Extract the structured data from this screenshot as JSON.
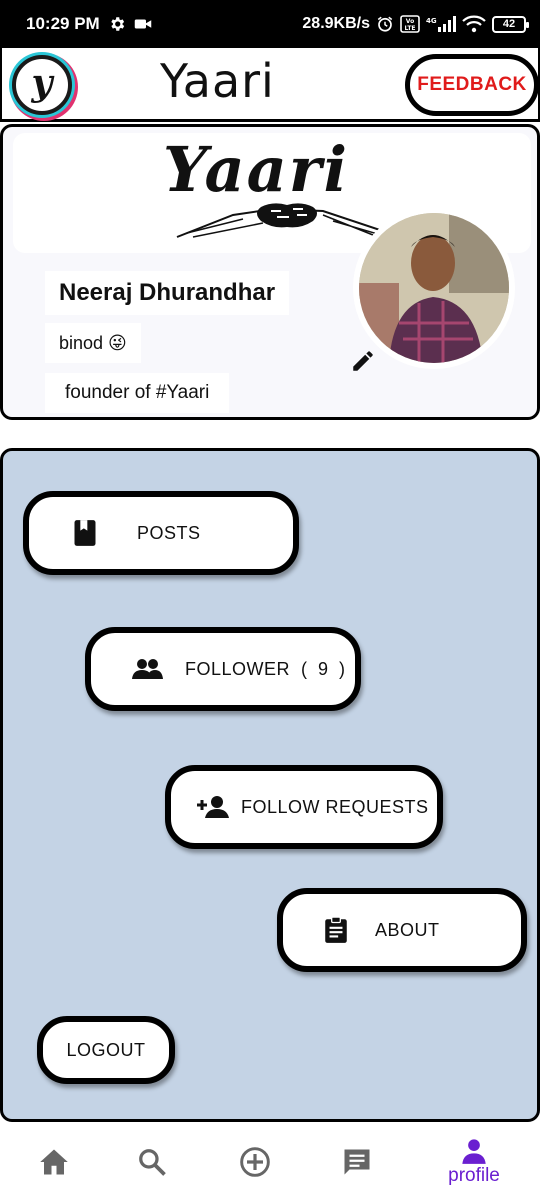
{
  "status_bar": {
    "time": "10:29 PM",
    "net_speed": "28.9KB/s",
    "network": "4G",
    "battery": "42"
  },
  "app_bar": {
    "logo_letter": "y",
    "title": "Yaari",
    "feedback_label": "FEEDBACK"
  },
  "profile": {
    "banner_text": "Yaari",
    "name": "Neeraj Dhurandhar",
    "status": "binod 😜",
    "bio": "founder of #Yaari"
  },
  "menu": {
    "posts_label": "POSTS",
    "follower_label": "FOLLOWER",
    "follower_count": "( 9 )",
    "follow_requests_label": "FOLLOW REQUESTS",
    "about_label": "ABOUT",
    "logout_label": "LOGOUT"
  },
  "bottom_nav": {
    "items": [
      {
        "icon": "home-icon"
      },
      {
        "icon": "search-icon"
      },
      {
        "icon": "add-circle-icon"
      },
      {
        "icon": "chat-icon"
      },
      {
        "icon": "person-icon",
        "label": "profile",
        "active": true
      }
    ],
    "active_color": "#6a1fd0",
    "inactive_color": "#666666"
  },
  "colors": {
    "feedback_text": "#e01b1b",
    "menu_panel_bg": "#c4d3e5"
  }
}
